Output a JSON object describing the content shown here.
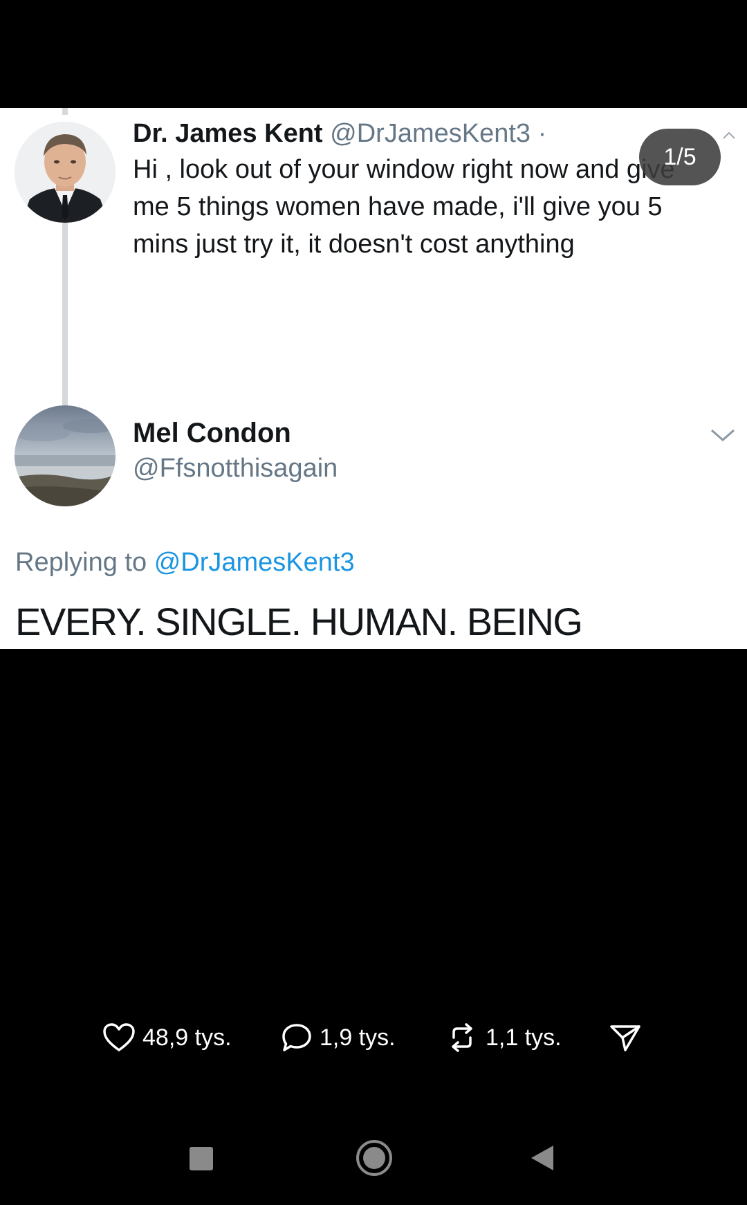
{
  "tweet1": {
    "name": "Dr. James Kent",
    "handle": "@DrJamesKent3 ·",
    "body": "Hi , look out of your window right now and give me 5 things women have made, i'll give you 5 mins just try it, it doesn't cost anything"
  },
  "tweet2": {
    "name": "Mel Condon",
    "handle": "@Ffsnotthisagain",
    "replying_prefix": "Replying to",
    "replying_mention": "@DrJamesKent3",
    "text": "EVERY. SINGLE. HUMAN. BEING"
  },
  "counter": "1/5",
  "actions": {
    "likes": "48,9 tys.",
    "comments": "1,9 tys.",
    "reposts": "1,1 tys."
  },
  "icons": {
    "like": "heart-icon",
    "comment": "comment-bubble-icon",
    "repost": "repost-icon",
    "share": "send-icon",
    "nav_recent": "square-icon",
    "nav_home": "circle-icon",
    "nav_back": "triangle-back-icon"
  }
}
